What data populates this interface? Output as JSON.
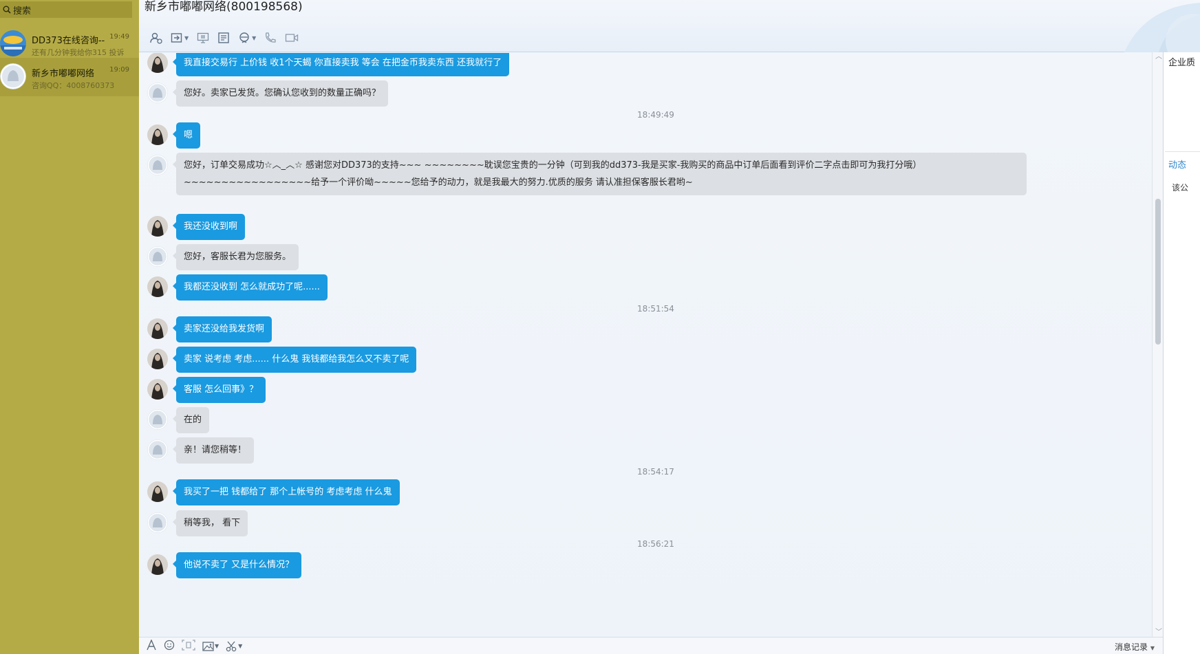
{
  "sidebar": {
    "search_label": "搜索",
    "conversations": [
      {
        "name": "DD373在线咨询--",
        "time": "19:49",
        "preview": "还有几分钟我给你315 投诉"
      },
      {
        "name": "新乡市嘟嘟网络",
        "time": "19:09",
        "preview": "咨询QQ：4008760373"
      }
    ]
  },
  "header": {
    "title": "新乡市嘟嘟网络(800198568)",
    "toolbar_icons": [
      "add-contact-icon",
      "transfer-file-icon",
      "remote-desktop-icon",
      "document-icon",
      "apps-icon",
      "phone-call-icon",
      "video-call-icon"
    ]
  },
  "chat": {
    "messages": [
      {
        "dir": "out",
        "text": "我直接交易行 上价钱 收1个天蝎 你直接卖我 等会 在把金币我卖东西 还我就行了"
      },
      {
        "dir": "in",
        "text": "您好。卖家已发货。您确认您收到的数量正确吗？"
      },
      {
        "dir": "out",
        "text": "嗯"
      },
      {
        "dir": "in",
        "text": "您好，订单交易成功☆︿_︿☆ 感谢您对DD373的支持~~~ ~~~~~~~~耽误您宝贵的一分钟（可到我的dd373-我是买家-我购买的商品中订单后面看到评价二字点击即可为我打分哦）~~~~~~~~~~~~~~~~~给予一个评价呦~~~~~您给予的动力，就是我最大的努力.优质的服务 请认准担保客服长君哟~"
      },
      {
        "dir": "out",
        "text": "我还没收到啊"
      },
      {
        "dir": "in",
        "text": "您好，客服长君为您服务。"
      },
      {
        "dir": "out",
        "text": "我都还没收到 怎么就成功了呢......"
      },
      {
        "dir": "out",
        "text": "卖家还没给我发货啊"
      },
      {
        "dir": "out",
        "text": "卖家 说考虑 考虑...... 什么鬼  我钱都给我怎么又不卖了呢"
      },
      {
        "dir": "out",
        "text": "客服 怎么回事》？"
      },
      {
        "dir": "in",
        "text": "在的"
      },
      {
        "dir": "in",
        "text": "亲！请您稍等！"
      },
      {
        "dir": "out",
        "text": "我买了一把 钱都给了  那个上帐号的 考虑考虑 什么鬼"
      },
      {
        "dir": "in",
        "text": "稍等我，  看下"
      },
      {
        "dir": "out",
        "text": "他说不卖了 又是什么情况？"
      }
    ],
    "timestamps": [
      "18:49:49",
      "18:51:54",
      "18:54:17",
      "18:56:21"
    ]
  },
  "right_panel": {
    "title_partial": "企业质",
    "tab_partial": "动态",
    "text_partial": "该公"
  },
  "bottom": {
    "tool_icons": [
      "font-icon",
      "emoji-icon",
      "screenshot-frame-icon",
      "image-icon",
      "scissors-icon"
    ],
    "history_label": "消息记录"
  }
}
